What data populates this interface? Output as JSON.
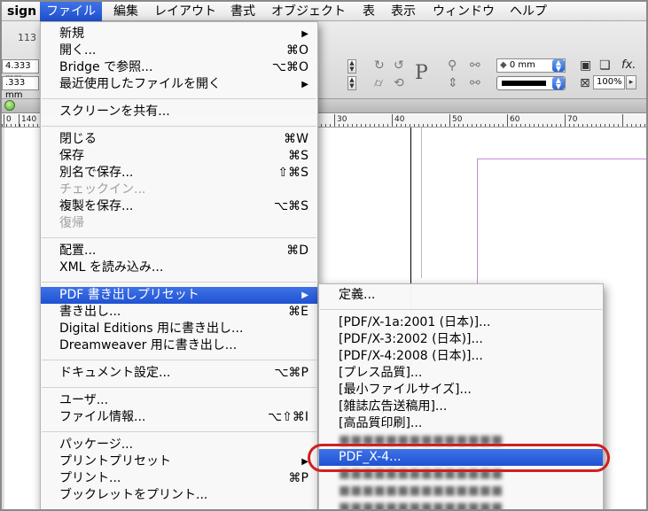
{
  "menubar": {
    "app": "sign",
    "items": [
      "ファイル",
      "編集",
      "レイアウト",
      "書式",
      "オブジェクト",
      "表",
      "表示",
      "ウィンドウ",
      "ヘルプ"
    ]
  },
  "control_panel": {
    "x_value": "4.333 mm",
    "y_value": ".333 mm",
    "left_number": "113",
    "stroke_value": "0 mm",
    "zoom_value": "100%",
    "p_glyph": "P",
    "fx_label": "fx."
  },
  "ruler": {
    "labels": [
      "0",
      "140",
      "30",
      "40",
      "50",
      "60",
      "70"
    ]
  },
  "file_menu": {
    "items": [
      {
        "label": "新規",
        "shortcut": "",
        "submenu": true
      },
      {
        "label": "開く...",
        "shortcut": "⌘O"
      },
      {
        "label": "Bridge で参照...",
        "shortcut": "⌥⌘O"
      },
      {
        "label": "最近使用したファイルを開く",
        "shortcut": "",
        "submenu": true
      },
      {
        "sep": true
      },
      {
        "label": "スクリーンを共有..."
      },
      {
        "sep": true
      },
      {
        "label": "閉じる",
        "shortcut": "⌘W"
      },
      {
        "label": "保存",
        "shortcut": "⌘S"
      },
      {
        "label": "別名で保存...",
        "shortcut": "⇧⌘S"
      },
      {
        "label": "チェックイン...",
        "disabled": true
      },
      {
        "label": "複製を保存...",
        "shortcut": "⌥⌘S"
      },
      {
        "label": "復帰",
        "disabled": true
      },
      {
        "sep": true
      },
      {
        "label": "配置...",
        "shortcut": "⌘D"
      },
      {
        "label": "XML を読み込み..."
      },
      {
        "sep": true
      },
      {
        "label": "PDF 書き出しプリセット",
        "submenu": true,
        "highlight": true
      },
      {
        "label": "書き出し...",
        "shortcut": "⌘E"
      },
      {
        "label": "Digital Editions 用に書き出し..."
      },
      {
        "label": "Dreamweaver 用に書き出し..."
      },
      {
        "sep": true
      },
      {
        "label": "ドキュメント設定...",
        "shortcut": "⌥⌘P"
      },
      {
        "sep": true
      },
      {
        "label": "ユーザ..."
      },
      {
        "label": "ファイル情報...",
        "shortcut": "⌥⇧⌘I"
      },
      {
        "sep": true
      },
      {
        "label": "パッケージ..."
      },
      {
        "label": "プリントプリセット",
        "submenu": true
      },
      {
        "label": "プリント...",
        "shortcut": "⌘P"
      },
      {
        "label": "ブックレットをプリント..."
      }
    ]
  },
  "pdf_submenu": {
    "items": [
      {
        "label": "定義..."
      },
      {
        "sep": true
      },
      {
        "label": "[PDF/X-1a:2001 (日本)]..."
      },
      {
        "label": "[PDF/X-3:2002 (日本)]..."
      },
      {
        "label": "[PDF/X-4:2008 (日本)]..."
      },
      {
        "label": "[プレス品質]..."
      },
      {
        "label": "[最小ファイルサイズ]..."
      },
      {
        "label": "[雑誌広告送稿用]..."
      },
      {
        "label": "[高品質印刷]..."
      },
      {
        "label": "",
        "blurred": true
      },
      {
        "label": "PDF_X-4...",
        "highlight": true
      },
      {
        "label": "",
        "blurred": true
      },
      {
        "label": "",
        "blurred": true
      },
      {
        "label": "",
        "blurred": true
      },
      {
        "label": "",
        "blurred": true
      }
    ]
  },
  "colors": {
    "highlight": "#2456d8",
    "annotation_ring": "#d11f1f",
    "page_guide": "#c98ad8"
  }
}
